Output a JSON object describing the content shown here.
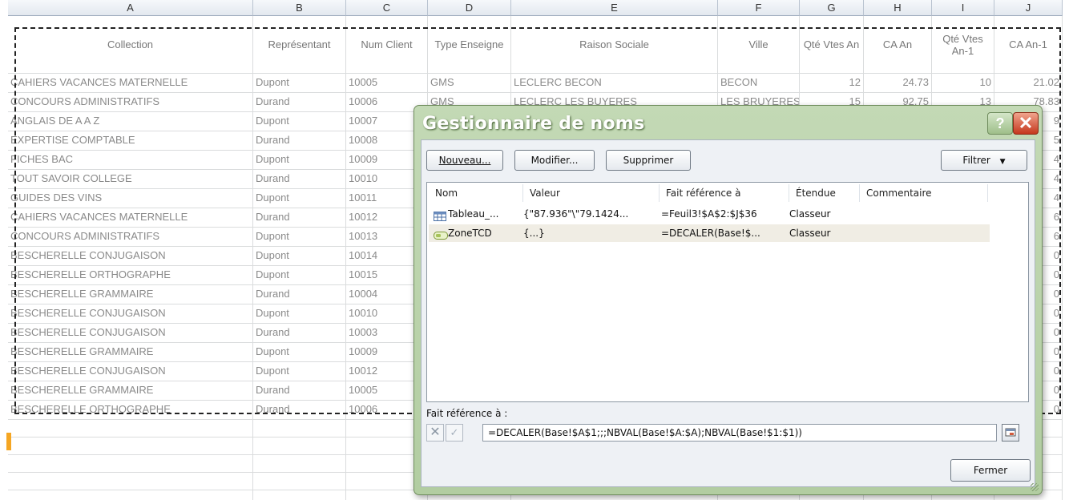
{
  "spreadsheet": {
    "column_letters": [
      "A",
      "B",
      "C",
      "D",
      "E",
      "F",
      "G",
      "H",
      "I",
      "J"
    ],
    "headers": [
      "Collection",
      "Représentant",
      "Num Client",
      "Type Enseigne",
      "Raison Sociale",
      "Ville",
      "Qté Vtes An",
      "CA An",
      "Qté Vtes An-1",
      "CA An-1"
    ],
    "rows": [
      [
        "CAHIERS VACANCES MATERNELLE",
        "Dupont",
        "10005",
        "GMS",
        "LECLERC BECON",
        "BECON",
        "12",
        "24.73",
        "10",
        "21.02"
      ],
      [
        "CONCOURS ADMINISTRATIFS",
        "Durand",
        "10006",
        "GMS",
        "LECLERC LES BUYERES",
        "LES BRUYERES",
        "15",
        "92.75",
        "13",
        "78.83"
      ],
      [
        "ANGLAIS DE A A Z",
        "Dupont",
        "10007",
        "",
        "",
        "",
        "",
        "",
        "",
        "9"
      ],
      [
        "EXPERTISE COMPTABLE",
        "Durand",
        "10008",
        "",
        "",
        "",
        "",
        "",
        "",
        "5"
      ],
      [
        "FICHES BAC",
        "Dupont",
        "10009",
        "",
        "",
        "",
        "",
        "",
        "",
        "4"
      ],
      [
        "TOUT SAVOIR COLLEGE",
        "Durand",
        "10010",
        "",
        "",
        "",
        "",
        "",
        "",
        "4"
      ],
      [
        "GUIDES DES VINS",
        "Dupont",
        "10011",
        "",
        "",
        "",
        "",
        "",
        "",
        "4"
      ],
      [
        "CAHIERS VACANCES MATERNELLE",
        "Durand",
        "10012",
        "",
        "",
        "",
        "",
        "",
        "",
        "6"
      ],
      [
        "CONCOURS ADMINISTRATIFS",
        "Dupont",
        "10013",
        "",
        "",
        "",
        "",
        "",
        "",
        "6"
      ],
      [
        "BESCHERELLE CONJUGAISON",
        "Dupont",
        "10014",
        "",
        "",
        "",
        "",
        "",
        "",
        "0"
      ],
      [
        "BESCHERELLE ORTHOGRAPHE",
        "Dupont",
        "10015",
        "",
        "",
        "",
        "",
        "",
        "",
        "0"
      ],
      [
        "BESCHERELLE GRAMMAIRE",
        "Durand",
        "10004",
        "",
        "",
        "",
        "",
        "",
        "",
        "0"
      ],
      [
        "BESCHERELLE CONJUGAISON",
        "Dupont",
        "10010",
        "",
        "",
        "",
        "",
        "",
        "",
        "0"
      ],
      [
        "BESCHERELLE CONJUGAISON",
        "Durand",
        "10003",
        "",
        "",
        "",
        "",
        "",
        "",
        "0"
      ],
      [
        "BESCHERELLE GRAMMAIRE",
        "Dupont",
        "10009",
        "",
        "",
        "",
        "",
        "",
        "",
        "0"
      ],
      [
        "BESCHERELLE CONJUGAISON",
        "Dupont",
        "10012",
        "",
        "",
        "",
        "",
        "",
        "",
        "0"
      ],
      [
        "BESCHERELLE GRAMMAIRE",
        "Durand",
        "10005",
        "",
        "",
        "",
        "",
        "",
        "",
        "0"
      ],
      [
        "BESCHERELLE ORTHOGRAPHE",
        "Durand",
        "10006",
        "",
        "",
        "",
        "",
        "",
        "",
        "0"
      ]
    ]
  },
  "dialog": {
    "title": "Gestionnaire de noms",
    "help_label": "?",
    "close_label": "✕",
    "buttons": {
      "new_label": "Nouveau...",
      "edit_label": "Modifier...",
      "delete_label": "Supprimer",
      "filter_label": "Filtrer",
      "close_label": "Fermer"
    },
    "list_headers": [
      "Nom",
      "Valeur",
      "Fait référence à",
      "Étendue",
      "Commentaire"
    ],
    "names": [
      {
        "name": "Tableau_...",
        "value": "{\"87.936\"\\\"79.1424...",
        "refers_to": "=Feuil3!$A$2:$J$36",
        "scope": "Classeur",
        "comment": "",
        "icon": "table-icon"
      },
      {
        "name": "ZoneTCD",
        "value": "{...}",
        "refers_to": "=DECALER(Base!$...",
        "scope": "Classeur",
        "comment": "",
        "icon": "named-range-icon"
      }
    ],
    "refers_label": "Fait référence à :",
    "refers_formula": "=DECALER(Base!$A$1;;;NBVAL(Base!$A:$A);NBVAL(Base!$1:$1))"
  },
  "colors": {
    "dialog_frame": "#b2cda1",
    "close_button": "#c5371d",
    "selection_highlight": "#f0ede4",
    "active_row_marker": "#f5a623"
  }
}
